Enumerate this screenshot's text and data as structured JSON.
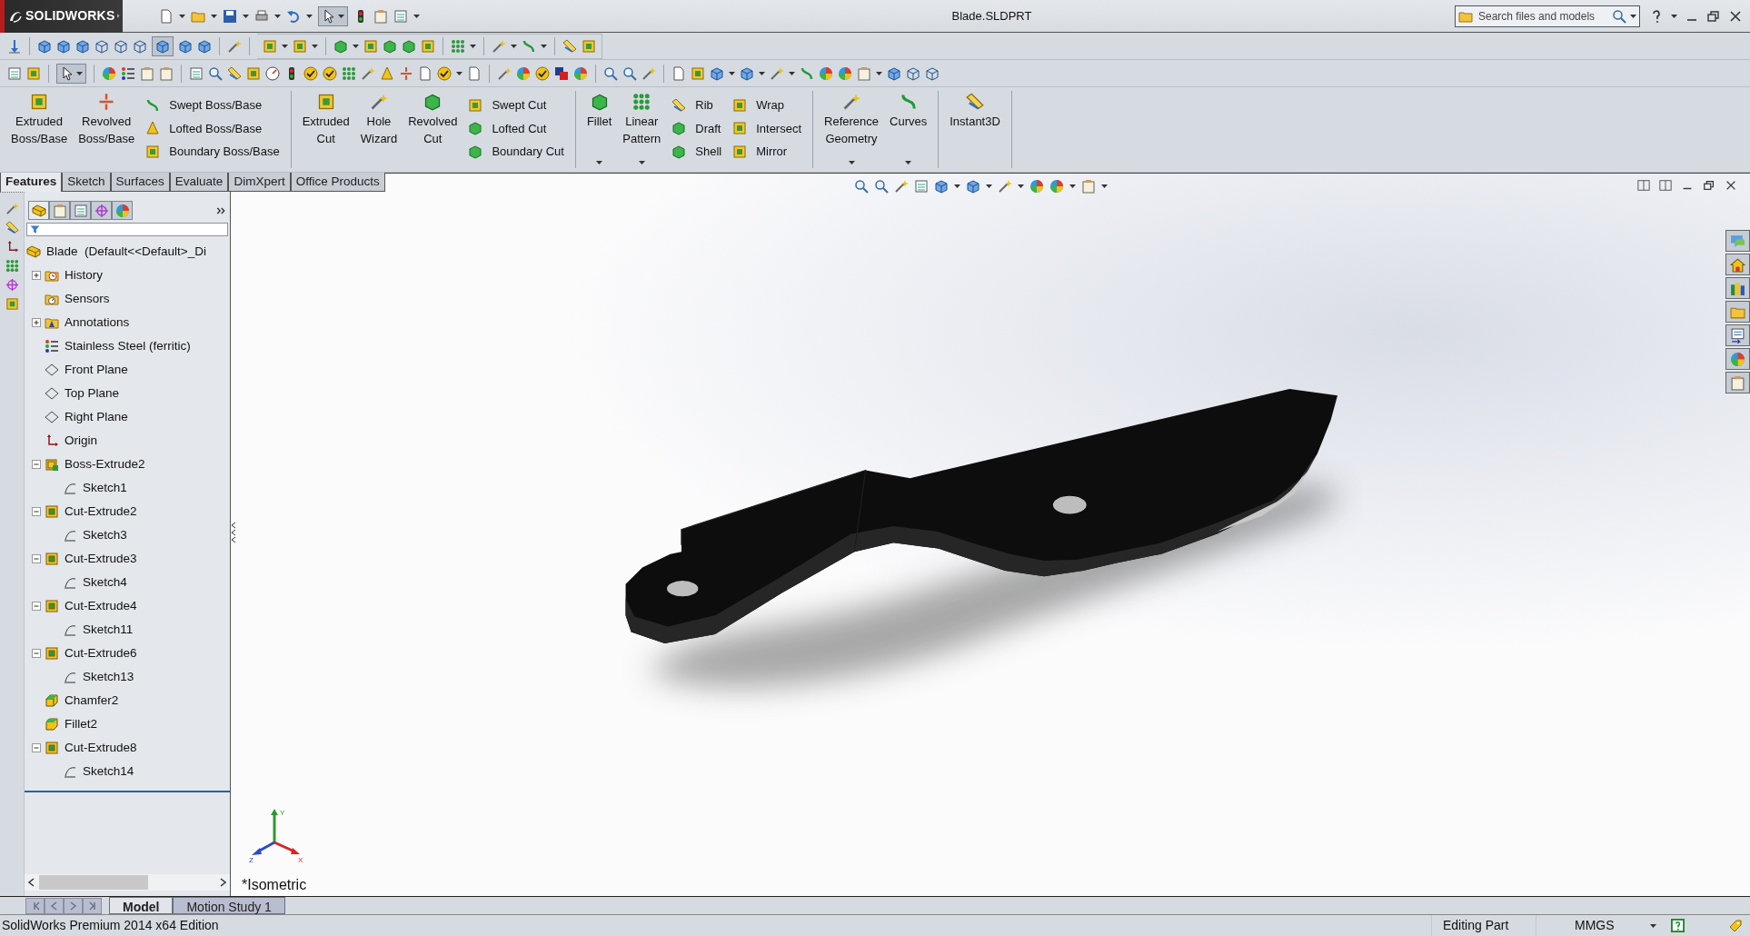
{
  "window": {
    "logo": "SOLIDWORKS",
    "title": "Blade.SLDPRT"
  },
  "search": {
    "placeholder": "Search files and models"
  },
  "toolbars": {
    "quick_select_pressed": true,
    "view_pressed": true,
    "select_pressed": true
  },
  "ribbon": [
    {
      "columns": [
        {
          "kind": "large",
          "label": "Extruded Boss/Base",
          "dropdown": false
        },
        {
          "kind": "large",
          "label": "Revolved Boss/Base",
          "dropdown": false
        },
        {
          "kind": "stack",
          "items": [
            "Swept Boss/Base",
            "Lofted Boss/Base",
            "Boundary Boss/Base"
          ]
        }
      ]
    },
    {
      "columns": [
        {
          "kind": "large",
          "label": "Extruded Cut",
          "dropdown": false
        },
        {
          "kind": "large",
          "label": "Hole Wizard",
          "dropdown": false
        },
        {
          "kind": "large",
          "label": "Revolved Cut",
          "dropdown": false
        },
        {
          "kind": "stack",
          "items": [
            "Swept Cut",
            "Lofted Cut",
            "Boundary Cut"
          ]
        }
      ]
    },
    {
      "columns": [
        {
          "kind": "large",
          "label": "Fillet",
          "dropdown": true
        },
        {
          "kind": "large",
          "label": "Linear Pattern",
          "dropdown": true
        },
        {
          "kind": "stack",
          "items": [
            "Rib",
            "Draft",
            "Shell"
          ]
        },
        {
          "kind": "stack",
          "items": [
            "Wrap",
            "Intersect",
            "Mirror"
          ]
        }
      ]
    },
    {
      "columns": [
        {
          "kind": "large",
          "label": "Reference Geometry",
          "dropdown": true
        },
        {
          "kind": "large",
          "label": "Curves",
          "dropdown": true
        }
      ]
    },
    {
      "columns": [
        {
          "kind": "large",
          "label": "Instant3D",
          "dropdown": false
        }
      ]
    }
  ],
  "command_tabs": [
    {
      "label": "Features",
      "selected": true
    },
    {
      "label": "Sketch",
      "selected": false
    },
    {
      "label": "Surfaces",
      "selected": false
    },
    {
      "label": "Evaluate",
      "selected": false
    },
    {
      "label": "DimXpert",
      "selected": false
    },
    {
      "label": "Office Products",
      "selected": false
    }
  ],
  "feature_tree": {
    "tabs": [
      {
        "selected": true
      },
      {
        "selected": false
      },
      {
        "selected": false
      },
      {
        "selected": false
      },
      {
        "selected": false
      }
    ],
    "root": {
      "label": "Blade  (Default<<Default>_Di"
    },
    "items": [
      {
        "label": "History",
        "kind": "history",
        "expanded": false
      },
      {
        "label": "Sensors",
        "kind": "sensors"
      },
      {
        "label": "Annotations",
        "kind": "annotations",
        "expanded": false
      },
      {
        "label": "Stainless Steel (ferritic)",
        "kind": "material"
      },
      {
        "label": "Front Plane",
        "kind": "plane"
      },
      {
        "label": "Top Plane",
        "kind": "plane"
      },
      {
        "label": "Right Plane",
        "kind": "plane"
      },
      {
        "label": "Origin",
        "kind": "origin"
      },
      {
        "label": "Boss-Extrude2",
        "kind": "boss",
        "expanded": true,
        "children": [
          {
            "label": "Sketch1",
            "kind": "sketch"
          }
        ]
      },
      {
        "label": "Cut-Extrude2",
        "kind": "cut",
        "expanded": true,
        "children": [
          {
            "label": "Sketch3",
            "kind": "sketch"
          }
        ]
      },
      {
        "label": "Cut-Extrude3",
        "kind": "cut",
        "expanded": true,
        "children": [
          {
            "label": "Sketch4",
            "kind": "sketch"
          }
        ]
      },
      {
        "label": "Cut-Extrude4",
        "kind": "cut",
        "expanded": true,
        "children": [
          {
            "label": "Sketch11",
            "kind": "sketch"
          }
        ]
      },
      {
        "label": "Cut-Extrude6",
        "kind": "cut",
        "expanded": true,
        "children": [
          {
            "label": "Sketch13",
            "kind": "sketch"
          }
        ]
      },
      {
        "label": "Chamfer2",
        "kind": "chamfer"
      },
      {
        "label": "Fillet2",
        "kind": "fillet"
      },
      {
        "label": "Cut-Extrude8",
        "kind": "cut",
        "expanded": true,
        "children": [
          {
            "label": "Sketch14",
            "kind": "sketch"
          }
        ]
      }
    ]
  },
  "viewport": {
    "view_label": "*Isometric",
    "triad": {
      "y": "Y",
      "z": "Z",
      "x": "X"
    }
  },
  "bottom_tabs": [
    {
      "label": "Model",
      "selected": true
    },
    {
      "label": "Motion Study 1",
      "selected": false
    }
  ],
  "status_bar": {
    "product": "SolidWorks Premium 2014 x64 Edition",
    "mode": "Editing Part",
    "units": "MMGS"
  }
}
